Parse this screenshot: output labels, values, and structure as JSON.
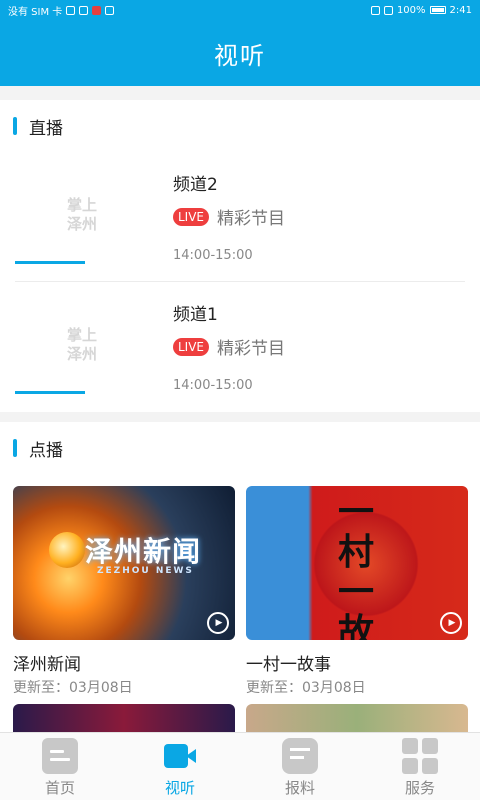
{
  "status_bar": {
    "carrier": "没有 SIM 卡",
    "battery": "100%",
    "time": "2:41"
  },
  "header": {
    "title": "视听"
  },
  "live": {
    "section_title": "直播",
    "placeholder_logo": "掌上\n泽州",
    "channels": [
      {
        "name": "频道2",
        "badge": "LIVE",
        "program": "精彩节目",
        "time": "14:00-15:00"
      },
      {
        "name": "频道1",
        "badge": "LIVE",
        "program": "精彩节目",
        "time": "14:00-15:00"
      }
    ]
  },
  "vod": {
    "section_title": "点播",
    "items": [
      {
        "title": "泽州新闻",
        "update": "更新至：03月08日",
        "thumb_text": "泽州新闻",
        "thumb_sub": "ZEZHOU NEWS"
      },
      {
        "title": "一村一故事",
        "update": "更新至：03月08日",
        "thumb_text": "一村一故事"
      }
    ]
  },
  "tabbar": {
    "tabs": [
      {
        "label": "首页",
        "icon": "home-icon",
        "active": false
      },
      {
        "label": "视听",
        "icon": "video-icon",
        "active": true
      },
      {
        "label": "报料",
        "icon": "report-icon",
        "active": false
      },
      {
        "label": "服务",
        "icon": "grid-icon",
        "active": false
      }
    ]
  },
  "colors": {
    "accent": "#0aa7e4",
    "live_badge": "#ee3e3e"
  }
}
